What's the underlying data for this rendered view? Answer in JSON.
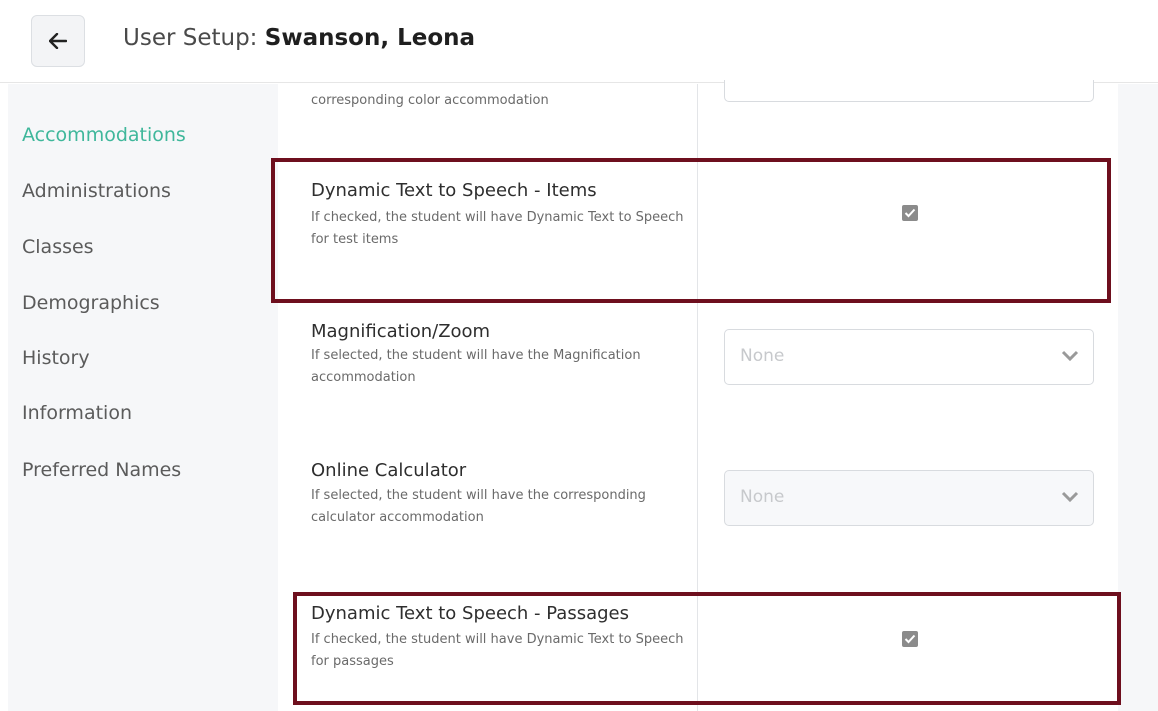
{
  "header": {
    "title_prefix": "User Setup: ",
    "user_name": "Swanson, Leona",
    "back_icon": "arrow-left-icon"
  },
  "sidebar": {
    "items": [
      {
        "label": "Accommodations",
        "active": true
      },
      {
        "label": "Administrations"
      },
      {
        "label": "Classes"
      },
      {
        "label": "Demographics"
      },
      {
        "label": "History"
      },
      {
        "label": "Information"
      },
      {
        "label": "Preferred Names"
      }
    ]
  },
  "main": {
    "partial_row": {
      "description": "corresponding color accommodation"
    },
    "rows": [
      {
        "title": "Dynamic Text to Speech - Items",
        "description": "If checked, the student will have Dynamic Text to Speech for test items",
        "control": "checkbox",
        "checked": true
      },
      {
        "title": "Magnification/Zoom",
        "description": "If selected, the student will have the Magnification accommodation",
        "control": "select",
        "value": "None"
      },
      {
        "title": "Online Calculator",
        "description": "If selected, the student will have the corresponding calculator accommodation",
        "control": "select",
        "value": "None",
        "disabled": true
      },
      {
        "title": "Dynamic Text to Speech - Passages",
        "description": "If checked, the student will have Dynamic Text to Speech for passages",
        "control": "checkbox",
        "checked": true
      }
    ]
  },
  "colors": {
    "accent": "#3fb79b",
    "highlight_border": "#6e0f1e"
  }
}
